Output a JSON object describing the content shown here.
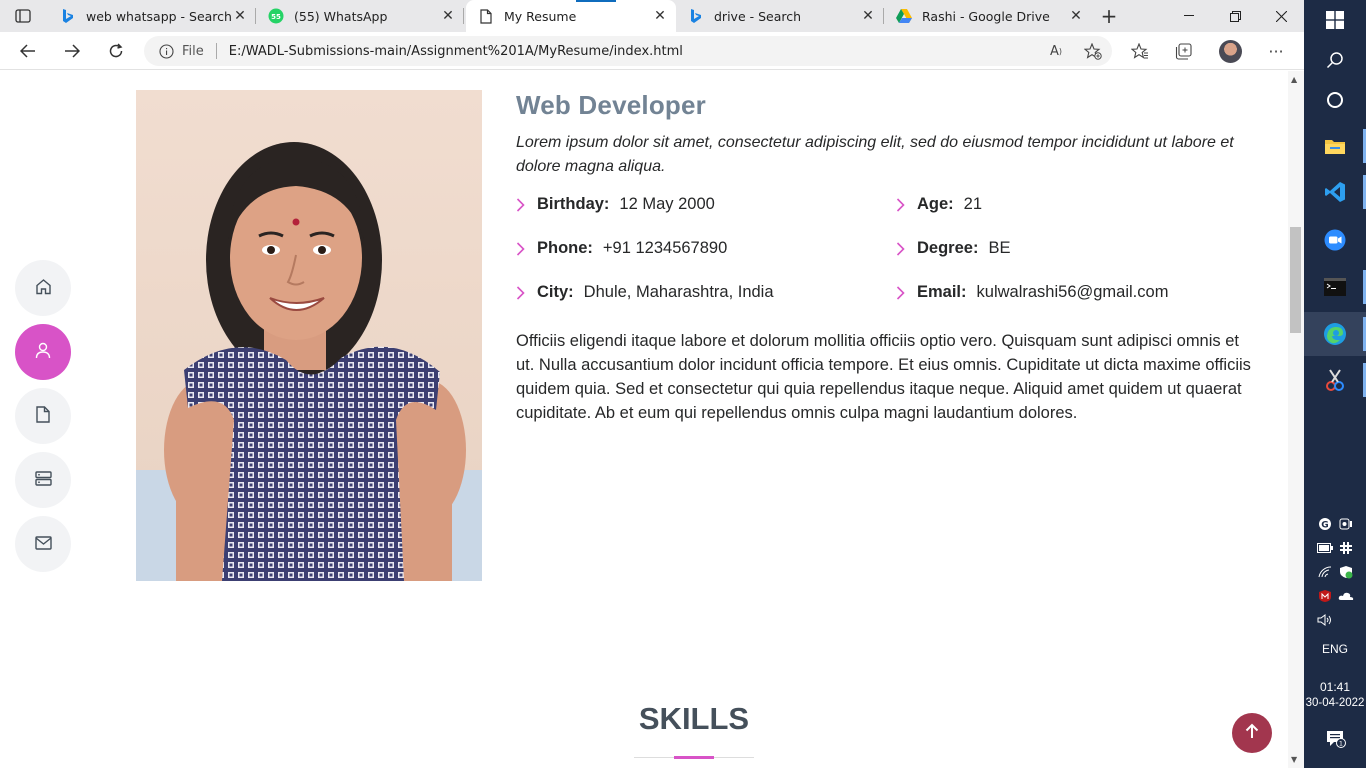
{
  "browser": {
    "tabs": [
      {
        "title": "web whatsapp - Search",
        "icon": "bing-icon"
      },
      {
        "title": "(55) WhatsApp",
        "icon": "whatsapp-icon"
      },
      {
        "title": "My Resume",
        "icon": "document-icon",
        "active": true
      },
      {
        "title": "drive - Search",
        "icon": "bing-icon"
      },
      {
        "title": "Rashi - Google Drive",
        "icon": "google-drive-icon"
      }
    ],
    "address": {
      "scheme_label": "File",
      "url": "E:/WADL-Submissions-main/Assignment%201A/MyResume/index.html"
    }
  },
  "sidenav": [
    "home-icon",
    "person-icon",
    "file-icon",
    "server-icon",
    "envelope-icon"
  ],
  "about": {
    "role": "Web Developer",
    "intro": "Lorem ipsum dolor sit amet, consectetur adipiscing elit, sed do eiusmod tempor incididunt ut labore et dolore magna aliqua.",
    "details": {
      "birthday": {
        "label": "Birthday:",
        "value": "12 May 2000"
      },
      "age": {
        "label": "Age:",
        "value": "21"
      },
      "phone": {
        "label": "Phone:",
        "value": "+91 1234567890"
      },
      "degree": {
        "label": "Degree:",
        "value": "BE"
      },
      "city": {
        "label": "City:",
        "value": "Dhule, Maharashtra, India"
      },
      "email": {
        "label": "Email:",
        "value": "kulwalrashi56@gmail.com"
      }
    },
    "bio": "Officiis eligendi itaque labore et dolorum mollitia officiis optio vero. Quisquam sunt adipisci omnis et ut. Nulla accusantium dolor incidunt officia tempore. Et eius omnis. Cupiditate ut dicta maxime officiis quidem quia. Sed et consectetur qui quia repellendus itaque neque. Aliquid amet quidem ut quaerat cupiditate. Ab et eum qui repellendus omnis culpa magni laudantium dolores."
  },
  "skills": {
    "title": "SKILLS"
  },
  "taskbar": {
    "language": "ENG",
    "time": "01:41",
    "date": "30-04-2022",
    "notification_count": "1"
  },
  "colors": {
    "accent": "#d853c7",
    "back_to_top": "#a2364e",
    "heading": "#728394",
    "taskbar": "#1d2b45"
  }
}
